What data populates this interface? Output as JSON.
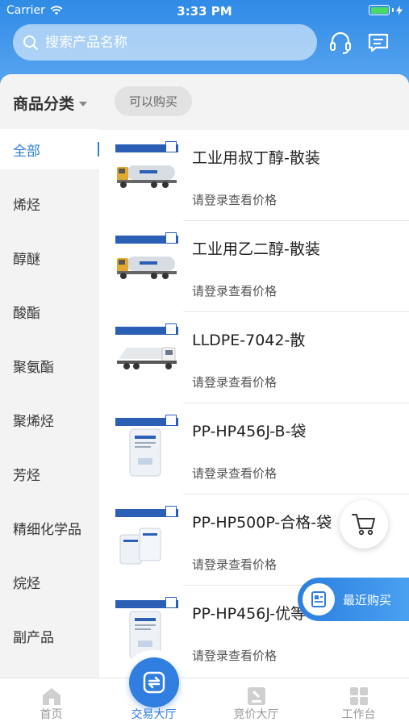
{
  "status_bar": {
    "carrier": "Carrier",
    "time": "3:33 PM"
  },
  "header": {
    "search_placeholder": "搜索产品名称",
    "icons": [
      "search-icon",
      "headset-icon",
      "message-icon"
    ]
  },
  "filters": {
    "category_title": "商品分类",
    "chip_label": "可以购买"
  },
  "sidebar": {
    "items": [
      {
        "label": "全部",
        "active": true
      },
      {
        "label": "烯烃"
      },
      {
        "label": "醇醚"
      },
      {
        "label": "酸酯"
      },
      {
        "label": "聚氨酯"
      },
      {
        "label": "聚烯烃"
      },
      {
        "label": "芳烃"
      },
      {
        "label": "精细化学品"
      },
      {
        "label": "烷烃"
      },
      {
        "label": "副产品"
      }
    ]
  },
  "products": [
    {
      "name": "工业用叔丁醇-散装",
      "price": "请登录查看价格",
      "image": "tanker-truck"
    },
    {
      "name": "工业用乙二醇-散装",
      "price": "请登录查看价格",
      "image": "tanker-truck"
    },
    {
      "name": "LLDPE-7042-散",
      "price": "请登录查看价格",
      "image": "bulk-truck"
    },
    {
      "name": "PP-HP456J-B-袋",
      "price": "请登录查看价格",
      "image": "bag"
    },
    {
      "name": "PP-HP500P-合格-袋",
      "price": "请登录查看价格",
      "image": "bags"
    },
    {
      "name": "PP-HP456J-优等",
      "price": "请登录查看价格",
      "image": "bag"
    }
  ],
  "floating": {
    "recent_label": "最近购买"
  },
  "tabbar": {
    "tabs": [
      {
        "label": "首页",
        "icon": "home-icon"
      },
      {
        "label": "交易大厅",
        "icon": "trade-icon",
        "active": true
      },
      {
        "label": "竞价大厅",
        "icon": "auction-icon"
      },
      {
        "label": "工作台",
        "icon": "workspace-icon"
      }
    ]
  },
  "colors": {
    "primary": "#2f7ee0",
    "header": "#4a9bec",
    "background": "#f3f3f3"
  }
}
